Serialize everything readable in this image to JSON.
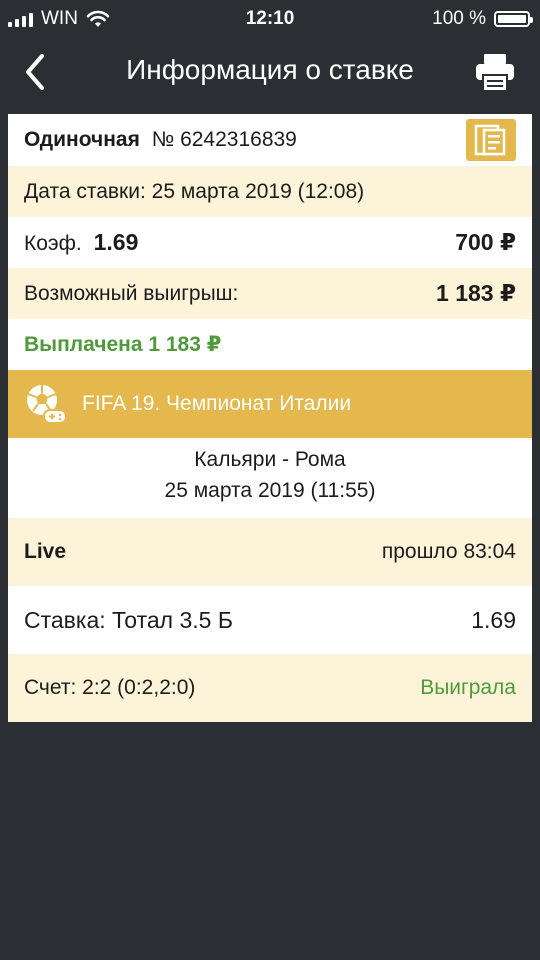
{
  "status_bar": {
    "carrier": "WIN",
    "time": "12:10",
    "battery": "100 %",
    "battery_level": 1.0
  },
  "nav": {
    "title": "Информация о ставке",
    "back_icon": "chevron-left-icon",
    "print_icon": "printer-icon"
  },
  "bet": {
    "type": "Одиночная",
    "number": "№ 6242316839",
    "date_label": "Дата ставки: 25 марта 2019 (12:08)",
    "coef_label": "Коэф.",
    "coef_value": "1.69",
    "stake": "700 ₽",
    "possible_win_label": "Возможный выигрыш:",
    "possible_win_value": "1 183 ₽",
    "paid": "Выплачена 1 183 ₽"
  },
  "event": {
    "league": "FIFA 19. Чемпионат Италии",
    "match": "Кальяри - Рома",
    "match_date": "25 марта 2019 (11:55)",
    "live_label": "Live",
    "elapsed": "прошло 83:04",
    "bet_label": "Ставка: Тотал 3.5 Б",
    "bet_coef": "1.69",
    "score": "Счет: 2:2 (0:2,2:0)",
    "result": "Выиграла"
  },
  "colors": {
    "background": "#2b2e33",
    "accent": "#e4b84c",
    "cream": "#fdf3d9",
    "win_green": "#4f9a3a"
  }
}
